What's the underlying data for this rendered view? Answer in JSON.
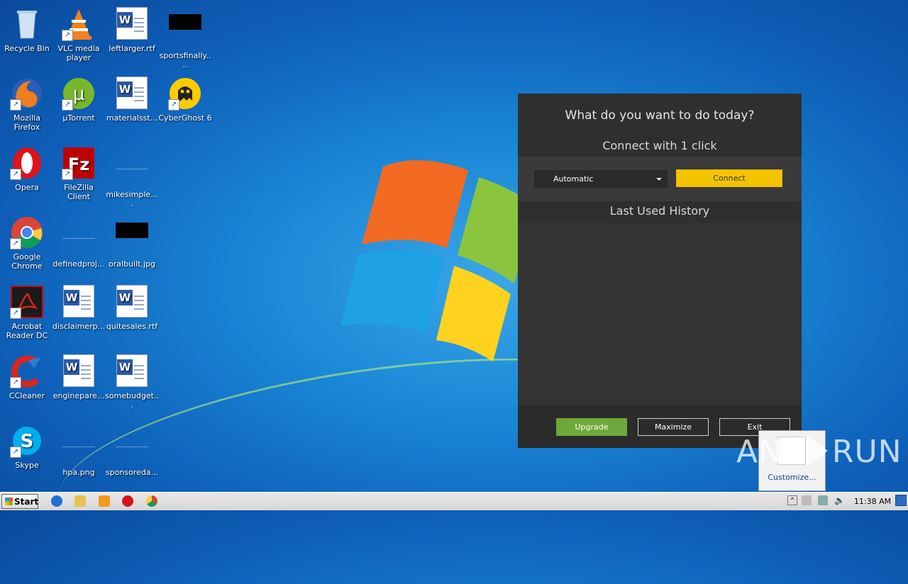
{
  "desktop": {
    "icons": [
      {
        "label": "Recycle Bin",
        "icon": "recycle-bin-icon"
      },
      {
        "label": "VLC media player",
        "icon": "vlc-icon"
      },
      {
        "label": "leftlarger.rtf",
        "icon": "word-document-icon"
      },
      {
        "label": "sportsfinally....",
        "icon": "image-file-icon"
      },
      {
        "label": "Mozilla Firefox",
        "icon": "firefox-icon"
      },
      {
        "label": "µTorrent",
        "icon": "utorrent-icon"
      },
      {
        "label": "materialsst...",
        "icon": "word-document-icon"
      },
      {
        "label": "CyberGhost 6",
        "icon": "cyberghost-icon"
      },
      {
        "label": "Opera",
        "icon": "opera-icon"
      },
      {
        "label": "FileZilla Client",
        "icon": "filezilla-icon"
      },
      {
        "label": "mikesimple....",
        "icon": "blank-file-icon"
      },
      {
        "label": "Google Chrome",
        "icon": "chrome-icon"
      },
      {
        "label": "definedproj...",
        "icon": "blank-file-icon"
      },
      {
        "label": "oralbuilt.jpg",
        "icon": "image-file-icon"
      },
      {
        "label": "Acrobat Reader DC",
        "icon": "acrobat-icon"
      },
      {
        "label": "disclaimerp...",
        "icon": "word-document-icon"
      },
      {
        "label": "quitesales.rtf",
        "icon": "word-document-icon"
      },
      {
        "label": "CCleaner",
        "icon": "ccleaner-icon"
      },
      {
        "label": "enginepare...",
        "icon": "word-document-icon"
      },
      {
        "label": "somebudget...",
        "icon": "word-document-icon"
      },
      {
        "label": "Skype",
        "icon": "skype-icon"
      },
      {
        "label": "hpa.png",
        "icon": "blank-file-icon"
      },
      {
        "label": "sponsoreda...",
        "icon": "blank-file-icon"
      }
    ]
  },
  "app": {
    "title": "What do you want to do today?",
    "connect_heading": "Connect with 1 click",
    "server_select_value": "Automatic",
    "connect_button": "Connect",
    "history_heading": "Last Used History",
    "upgrade_button": "Upgrade",
    "maximize_button": "Maximize",
    "exit_button": "Exit",
    "accent_color": "#f5c400",
    "upgrade_color": "#6fa83a"
  },
  "notification": {
    "customize_label": "Customize..."
  },
  "watermark": {
    "left": "ANY",
    "right": "RUN"
  },
  "taskbar": {
    "start_label": "Start",
    "pinned": [
      "internet-explorer-icon",
      "explorer-folder-icon",
      "media-player-icon",
      "opera-icon",
      "chrome-icon"
    ],
    "clock": "11:38 AM"
  }
}
